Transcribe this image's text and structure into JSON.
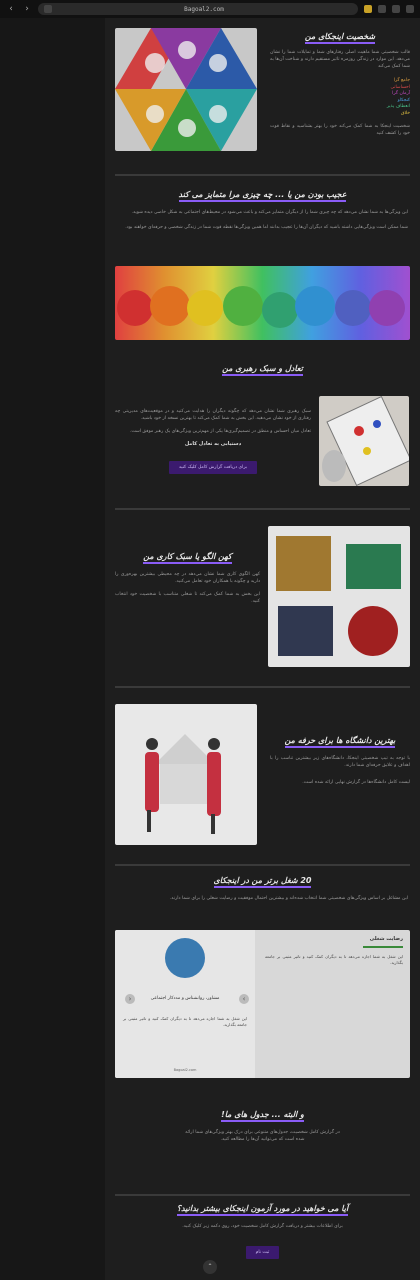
{
  "browser": {
    "url": "Bagoal2.com",
    "back_icon": "chevron-left-icon",
    "forward_icon": "chevron-right-icon"
  },
  "sections": {
    "personality": {
      "title": "شخصیت اینجکای من",
      "para": "قالب شخصیتی شما ماهیت اصلی رفتارهای شما و تمایلات شما را نشان می‌دهد. این موارد در زندگی روزمره تاثیر مستقیم دارند و شناخت آن‌ها به شما کمک می‌کند",
      "traits": [
        "جامع گرا",
        "احساساتی",
        "آرمان گرا",
        "کنجکاو",
        "انعطاف پذیر",
        "خلاق"
      ],
      "trait_colors": [
        "#e0a040",
        "#d94a4a",
        "#c44ac4",
        "#4aa0e0",
        "#4ac48a",
        "#e0c040"
      ],
      "footer": "شخصیت اینجکا به شما کمک می‌کند خود را بهتر بشناسید و نقاط قوت خود را کشف کنید"
    },
    "funny": {
      "title": "عجیب بودن من یا ... چه چیزی مرا متمایز می کند",
      "para1": "این ویژگی‌ها به شما نشان می‌دهد که چه چیزی شما را از دیگران متمایز می‌کند و باعث می‌شود در محیط‌های اجتماعی به شکل خاصی دیده شوید.",
      "para2": "شما ممکن است ویژگی‌هایی داشته باشید که دیگران آن‌ها را عجیب بدانند اما همین ویژگی‌ها نقطه قوت شما در زندگی شخصی و حرفه‌ای خواهند بود."
    },
    "balance": {
      "title": "تعادل و سبک رهبری من",
      "para1": "سبک رهبری شما نشان می‌دهد که چگونه دیگران را هدایت می‌کنید و در موقعیت‌های مدیریتی چه رفتاری از خود نشان می‌دهید. این بخش به شما کمک می‌کند تا بهترین نسخه از خود باشید.",
      "para2": "تعادل میان احساس و منطق در تصمیم‌گیری‌ها یکی از مهم‌ترین ویژگی‌های یک رهبر موفق است.",
      "subtitle": "دستیابی به تعادل کامل",
      "button": "برای دریافت گزارش کامل کلیک کنید"
    },
    "work": {
      "title": "کهن الگو یا سبک کاری من",
      "para1": "کهن الگوی کاری شما نشان می‌دهد در چه محیطی بیشترین بهره‌وری را دارید و چگونه با همکاران خود تعامل می‌کنید.",
      "para2": "این بخش به شما کمک می‌کند تا شغلی متناسب با شخصیت خود انتخاب کنید."
    },
    "uni": {
      "title": "بهترین دانشگاه ها برای حرفه من",
      "para1": "با توجه به تیپ شخصیتی اینجکا، دانشگاه‌های زیر بیشترین تناسب را با اهداف و علایق حرفه‌ای شما دارند.",
      "para2": "لیست کامل دانشگاه‌ها در گزارش نهایی ارائه شده است."
    },
    "careers": {
      "title": "20 شغل برتر من در اینجکای",
      "para": "این مشاغل بر اساس ویژگی‌های شخصیتی شما انتخاب شده‌اند و بیشترین احتمال موفقیت و رضایت شغلی را برای شما دارند.",
      "card_title": "مشاور، روانشناس و مددکار اجتماعی",
      "card_heading": "رضایت شغلی",
      "card_text": "این شغل به شما اجازه می‌دهد تا به دیگران کمک کنید و تاثیر مثبتی بر جامعه بگذارید.",
      "card_footer": "Bagoal2.com"
    },
    "final": {
      "title": "و البته ... جدول های ما!",
      "para": "در گزارش کامل شخصیت، جدول‌های متنوعی برای درک بهتر ویژگی‌های شما ارائه شده است که می‌توانید آن‌ها را مطالعه کنید."
    },
    "cta": {
      "title": "آیا می خواهید در مورد آزمون اینجکای بیشتر بدانید؟",
      "para": "برای اطلاعات بیشتر و دریافت گزارش کامل شخصیت خود، روی دکمه زیر کلیک کنید.",
      "button": "ثبت نام"
    }
  }
}
